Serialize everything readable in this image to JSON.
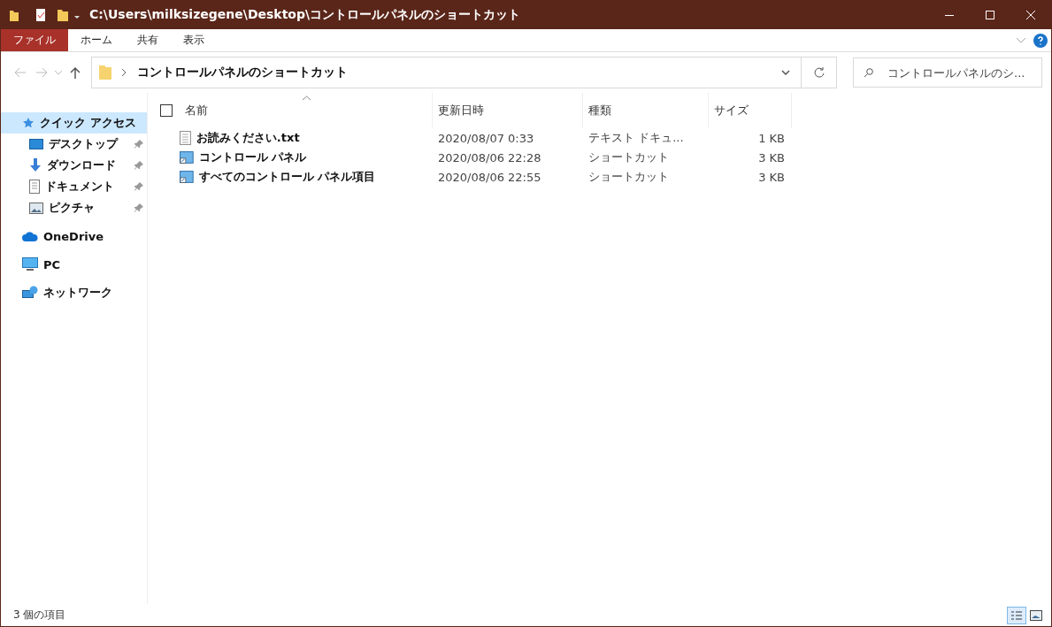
{
  "window": {
    "title": "C:\\Users\\milksizegene\\Desktop\\コントロールパネルのショートカット"
  },
  "ribbon_tabs": [
    {
      "label": "ファイル",
      "selected": true
    },
    {
      "label": "ホーム",
      "selected": false
    },
    {
      "label": "共有",
      "selected": false
    },
    {
      "label": "表示",
      "selected": false
    }
  ],
  "address": {
    "crumb": "コントロールパネルのショートカット"
  },
  "search": {
    "placeholder": "コントロールパネルのシ..."
  },
  "sidebar": {
    "items": [
      {
        "label": "クイック アクセス",
        "kind": "star",
        "selected": true,
        "children": [
          {
            "label": "デスクトップ",
            "kind": "desktop",
            "pinned": true,
            "selected": false
          },
          {
            "label": "ダウンロード",
            "kind": "download",
            "pinned": true,
            "selected": false
          },
          {
            "label": "ドキュメント",
            "kind": "document",
            "pinned": true,
            "selected": false
          },
          {
            "label": "ピクチャ",
            "kind": "picture",
            "pinned": true,
            "selected": false
          }
        ]
      },
      {
        "label": "OneDrive",
        "kind": "cloud",
        "selected": false
      },
      {
        "label": "PC",
        "kind": "pc",
        "selected": false
      },
      {
        "label": "ネットワーク",
        "kind": "network",
        "selected": false
      }
    ]
  },
  "table": {
    "select_all": {
      "checked": false
    },
    "columns": [
      "名前",
      "更新日時",
      "種類",
      "サイズ"
    ],
    "rows": [
      {
        "kind": "text",
        "name": "お読みください.txt",
        "modified": "2020/08/07 0:33",
        "type": "テキスト ドキュ...",
        "size": "1 KB"
      },
      {
        "kind": "shortcut",
        "name": "コントロール パネル",
        "modified": "2020/08/06 22:28",
        "type": "ショートカット",
        "size": "3 KB"
      },
      {
        "kind": "shortcut",
        "name": "すべてのコントロール パネル項目",
        "modified": "2020/08/06 22:55",
        "type": "ショートカット",
        "size": "3 KB"
      }
    ]
  },
  "status_bar": {
    "count": "3 個の項目",
    "views": [
      {
        "kind": "details",
        "selected": true
      },
      {
        "kind": "large_icons",
        "selected": false
      }
    ]
  }
}
